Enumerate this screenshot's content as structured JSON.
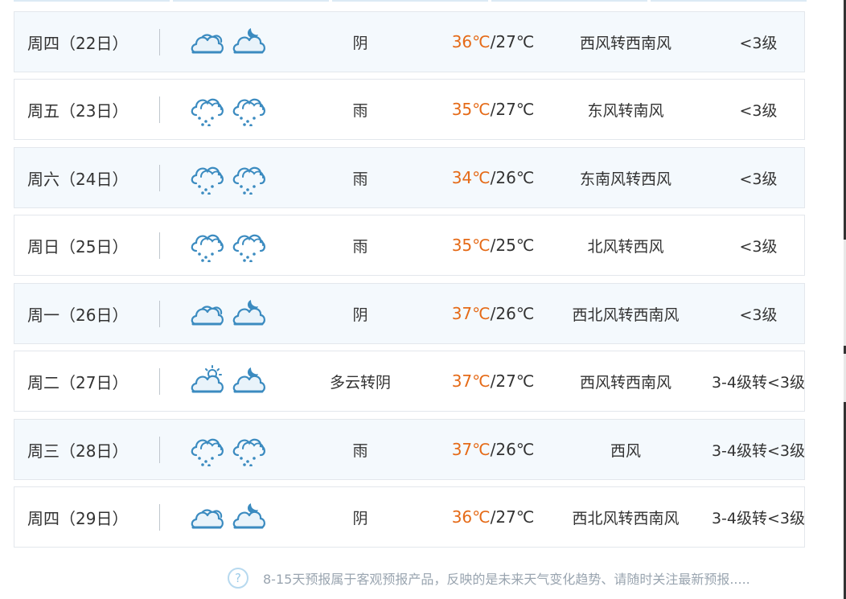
{
  "forecast": {
    "rows": [
      {
        "day": "周四（22日）",
        "icon_day": "overcast-icon",
        "icon_night": "cloudy-night-icon",
        "desc": "阴",
        "high": "36℃",
        "low": "/27℃",
        "wind": "西风转西南风",
        "level": "<3级"
      },
      {
        "day": "周五（23日）",
        "icon_day": "rain-icon",
        "icon_night": "rain-icon",
        "desc": "雨",
        "high": "35℃",
        "low": "/27℃",
        "wind": "东风转南风",
        "level": "<3级"
      },
      {
        "day": "周六（24日）",
        "icon_day": "rain-icon",
        "icon_night": "rain-icon",
        "desc": "雨",
        "high": "34℃",
        "low": "/26℃",
        "wind": "东南风转西风",
        "level": "<3级"
      },
      {
        "day": "周日（25日）",
        "icon_day": "rain-icon",
        "icon_night": "rain-icon",
        "desc": "雨",
        "high": "35℃",
        "low": "/25℃",
        "wind": "北风转西风",
        "level": "<3级"
      },
      {
        "day": "周一（26日）",
        "icon_day": "overcast-icon",
        "icon_night": "cloudy-night-icon",
        "desc": "阴",
        "high": "37℃",
        "low": "/26℃",
        "wind": "西北风转西南风",
        "level": "<3级"
      },
      {
        "day": "周二（27日）",
        "icon_day": "partly-cloudy-icon",
        "icon_night": "cloudy-night-icon",
        "desc": "多云转阴",
        "high": "37℃",
        "low": "/27℃",
        "wind": "西风转西南风",
        "level": "3-4级转<3级"
      },
      {
        "day": "周三（28日）",
        "icon_day": "rain-icon",
        "icon_night": "rain-icon",
        "desc": "雨",
        "high": "37℃",
        "low": "/26℃",
        "wind": "西风",
        "level": "3-4级转<3级"
      },
      {
        "day": "周四（29日）",
        "icon_day": "overcast-icon",
        "icon_night": "cloudy-night-icon",
        "desc": "阴",
        "high": "36℃",
        "low": "/27℃",
        "wind": "西北风转西南风",
        "level": "3-4级转<3级"
      }
    ]
  },
  "note": {
    "icon": "question-icon",
    "text": "8-15天预报属于客观预报产品，反映的是未来天气变化趋势、请随时关注最新预报....."
  },
  "colors": {
    "accent_temp": "#e56a17",
    "icon_blue": "#3b8bc0",
    "row_shaded": "#f4f9fd",
    "border": "#e3e7ec"
  }
}
